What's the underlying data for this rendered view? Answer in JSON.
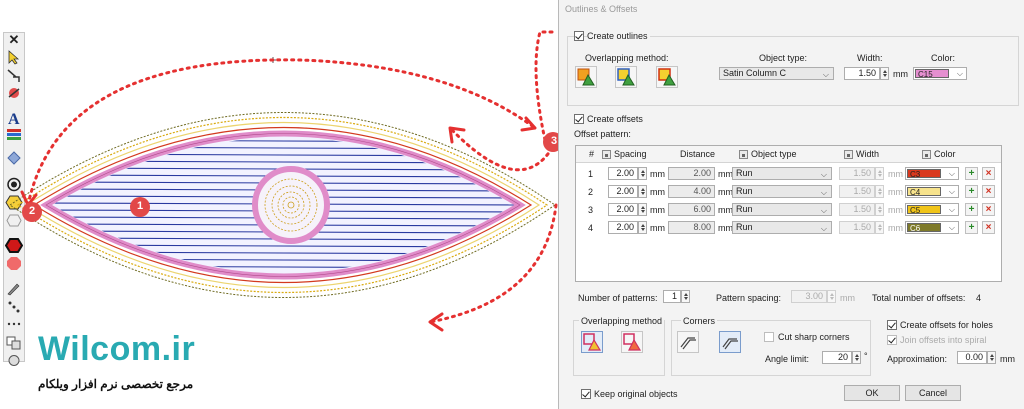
{
  "brand": {
    "name": "Wilcom.ir",
    "tagline": "مرجع تخصصی نرم افزار ویلکام"
  },
  "annotations": {
    "marker1": "1",
    "marker2": "2",
    "marker3": "3"
  },
  "toolbar": {
    "close_glyph": "✕",
    "icons": [
      "select-arrow-icon",
      "reshape-icon",
      "stitch-edit-icon",
      "lettering-icon",
      "monogram-icon",
      "elements-icon",
      "offset-icon",
      "outline-icon",
      "hexagon-icon",
      "shape-outline-icon",
      "hexagon-filled-icon",
      "octagon-red-icon",
      "pencil-icon",
      "dots-icon",
      "dots-small-icon",
      "shapes-icon",
      "circle-shape-icon"
    ]
  },
  "dialog": {
    "title": "Outlines & Offsets",
    "create_outlines": {
      "label": "Create outlines",
      "checked": true
    },
    "overlapping_method_label": "Overlapping method:",
    "object_type_label": "Object type:",
    "object_type_value": "Satin Column C",
    "width_label": "Width:",
    "width_value": "1.50",
    "width_unit": "mm",
    "color_label": "Color:",
    "color_value": "C15",
    "color_hex": "#e58fd0",
    "create_offsets": {
      "label": "Create offsets",
      "checked": true
    },
    "offset_pattern_label": "Offset pattern:",
    "table": {
      "headers": {
        "num": "#",
        "spacing": "Spacing",
        "distance": "Distance",
        "object_type": "Object type",
        "width": "Width",
        "color": "Color"
      },
      "rows": [
        {
          "num": "1",
          "spacing": "2.00",
          "distance": "2.00",
          "object_type": "Run",
          "width": "1.50",
          "color": "C3",
          "color_hex": "#d9381e"
        },
        {
          "num": "2",
          "spacing": "2.00",
          "distance": "4.00",
          "object_type": "Run",
          "width": "1.50",
          "color": "C4",
          "color_hex": "#f7e38c"
        },
        {
          "num": "3",
          "spacing": "2.00",
          "distance": "6.00",
          "object_type": "Run",
          "width": "1.50",
          "color": "C5",
          "color_hex": "#f0c419"
        },
        {
          "num": "4",
          "spacing": "2.00",
          "distance": "8.00",
          "object_type": "Run",
          "width": "1.50",
          "color": "C6",
          "color_hex": "#7e7a2a"
        }
      ],
      "unit": "mm"
    },
    "number_of_patterns_label": "Number of patterns:",
    "number_of_patterns_value": "1",
    "pattern_spacing_label": "Pattern spacing:",
    "pattern_spacing_value": "3.00",
    "pattern_spacing_unit": "mm",
    "total_offsets_label": "Total number of offsets:",
    "total_offsets_value": "4",
    "overlapping_method_group": "Overlapping method",
    "corners_group": "Corners",
    "cut_sharp_corners": {
      "label": "Cut sharp corners",
      "checked": false
    },
    "angle_limit_label": "Angle limit:",
    "angle_limit_value": "20",
    "angle_unit": "°",
    "create_offsets_for_holes": {
      "label": "Create offsets for holes",
      "checked": true
    },
    "join_offsets_into_spiral": {
      "label": "Join offsets into spiral",
      "checked": true
    },
    "approximation_label": "Approximation:",
    "approximation_value": "0.00",
    "approximation_unit": "mm",
    "keep_original": {
      "label": "Keep original objects",
      "checked": true
    },
    "ok_label": "OK",
    "cancel_label": "Cancel"
  }
}
